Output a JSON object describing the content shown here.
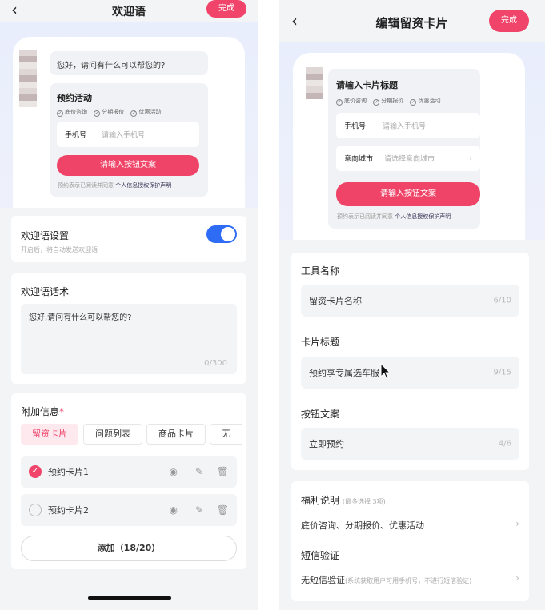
{
  "left": {
    "header": {
      "back_icon": "chevron-left-icon",
      "title": "欢迎语",
      "done_label": "完成"
    },
    "preview": {
      "greeting": "您好，请问有什么可以帮您的?",
      "card_title": "预约活动",
      "tags": [
        "底价咨询",
        "分期报价",
        "优惠活动"
      ],
      "phone_label": "手机号",
      "phone_placeholder": "请输入手机号",
      "cta": "请输入按钮文案",
      "consent_prefix": "预约表示已阅读并同意",
      "consent_link": "个人信息授权保护声明"
    },
    "welcome_setting": {
      "title": "欢迎语设置",
      "desc": "开启后，将自动发送欢迎语",
      "enabled": true
    },
    "welcome_script": {
      "title": "欢迎语话术",
      "text": "您好,请问有什么可以帮您的?",
      "counter": "0/300"
    },
    "extra_info": {
      "title": "附加信息",
      "required_mark": "*",
      "tabs": [
        {
          "label": "留资卡片",
          "active": true
        },
        {
          "label": "问题列表",
          "active": false
        },
        {
          "label": "商品卡片",
          "active": false
        },
        {
          "label": "无",
          "active": false
        }
      ],
      "cards": [
        {
          "label": "预约卡片1",
          "checked": true
        },
        {
          "label": "预约卡片2",
          "checked": false
        }
      ],
      "add_label": "添加（18/20）"
    }
  },
  "right": {
    "header": {
      "back_icon": "chevron-left-icon",
      "title": "编辑留资卡片",
      "done_label": "完成"
    },
    "preview": {
      "card_title": "请输入卡片标题",
      "tags": [
        "底价咨询",
        "分期报价",
        "优惠活动"
      ],
      "phone_label": "手机号",
      "phone_placeholder": "请输入手机号",
      "city_label": "意向城市",
      "city_placeholder": "请选择意向城市",
      "cta": "请输入按钮文案",
      "consent_prefix": "预约表示已阅读并同意",
      "consent_link": "个人信息授权保护声明"
    },
    "form": {
      "tool_name": {
        "label": "工具名称",
        "value": "留资卡片名称",
        "counter": "6/10"
      },
      "card_title": {
        "label": "卡片标题",
        "value": "预约享专属选车服",
        "counter": "9/15"
      },
      "button_text": {
        "label": "按钮文案",
        "value": "立即预约",
        "counter": "4/6"
      }
    },
    "benefits": {
      "label": "福利说明",
      "hint": "(最多选择 3项)",
      "value": "底价咨询、分期报价、优惠活动"
    },
    "sms": {
      "label": "短信验证",
      "value": "无短信验证",
      "hint": "(系统获取用户可用手机号，不进行短信验证)"
    }
  }
}
